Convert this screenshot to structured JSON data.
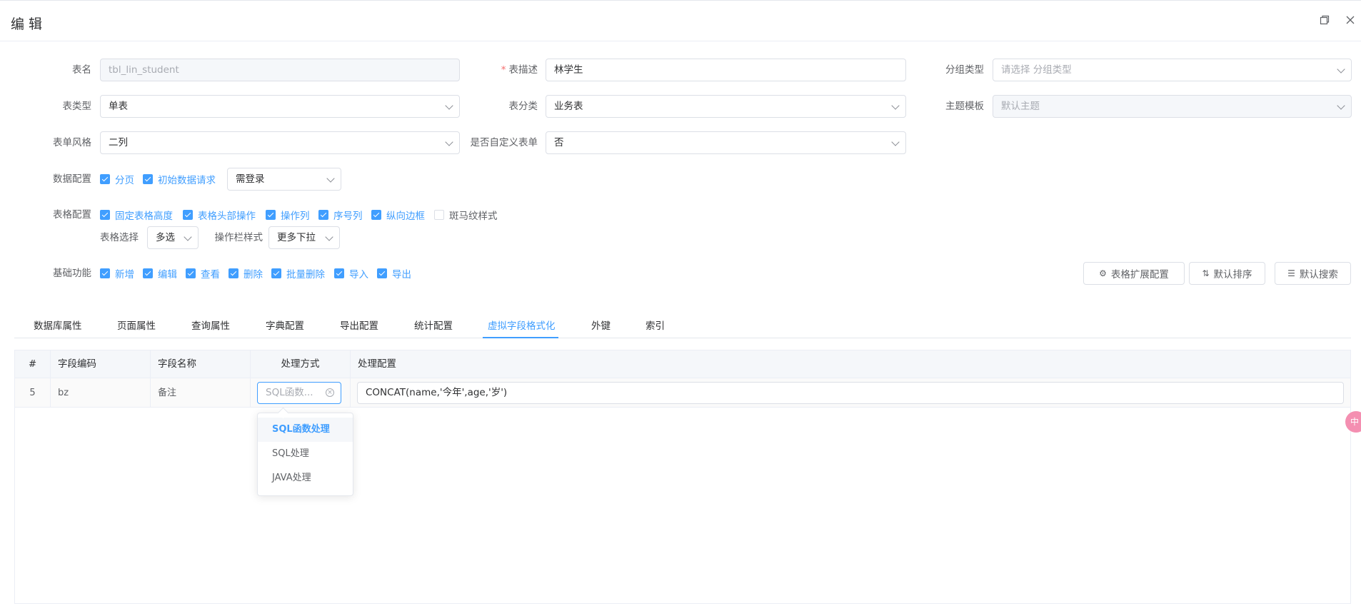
{
  "dialog": {
    "title": "编 辑",
    "restore_icon": "restore-icon",
    "close_icon": "close-icon"
  },
  "form": {
    "table_name": {
      "label": "表名",
      "value": "tbl_lin_student"
    },
    "table_desc": {
      "label": "表描述",
      "required_mark": "*",
      "value": "林学生"
    },
    "group_type": {
      "label": "分组类型",
      "placeholder": "请选择 分组类型"
    },
    "table_type": {
      "label": "表类型",
      "value": "单表"
    },
    "table_category": {
      "label": "表分类",
      "value": "业务表"
    },
    "theme_template": {
      "label": "主题模板",
      "value": "默认主题"
    },
    "form_style": {
      "label": "表单风格",
      "value": "二列"
    },
    "custom_form": {
      "label": "是否自定义表单",
      "value": "否"
    },
    "data_config": {
      "label": "数据配置",
      "checks": [
        {
          "label": "分页",
          "checked": true
        },
        {
          "label": "初始数据请求",
          "checked": true
        }
      ],
      "login_select": "需登录"
    },
    "table_config": {
      "label": "表格配置",
      "checks": [
        {
          "label": "固定表格高度",
          "checked": true
        },
        {
          "label": "表格头部操作",
          "checked": true
        },
        {
          "label": "操作列",
          "checked": true
        },
        {
          "label": "序号列",
          "checked": true
        },
        {
          "label": "纵向边框",
          "checked": true
        },
        {
          "label": "斑马纹样式",
          "checked": false
        }
      ],
      "select_label": "表格选择",
      "select_value": "多选",
      "action_style_label": "操作栏样式",
      "action_style_value": "更多下拉"
    },
    "basic_functions": {
      "label": "基础功能",
      "checks": [
        {
          "label": "新增",
          "checked": true
        },
        {
          "label": "编辑",
          "checked": true
        },
        {
          "label": "查看",
          "checked": true
        },
        {
          "label": "删除",
          "checked": true
        },
        {
          "label": "批量删除",
          "checked": true
        },
        {
          "label": "导入",
          "checked": true
        },
        {
          "label": "导出",
          "checked": true
        }
      ]
    }
  },
  "buttons": {
    "table_ext": "表格扩展配置",
    "default_sort": "默认排序",
    "default_search": "默认搜索"
  },
  "tabs": [
    {
      "label": "数据库属性",
      "active": false
    },
    {
      "label": "页面属性",
      "active": false
    },
    {
      "label": "查询属性",
      "active": false
    },
    {
      "label": "字典配置",
      "active": false
    },
    {
      "label": "导出配置",
      "active": false
    },
    {
      "label": "统计配置",
      "active": false
    },
    {
      "label": "虚拟字段格式化",
      "active": true
    },
    {
      "label": "外键",
      "active": false
    },
    {
      "label": "索引",
      "active": false
    }
  ],
  "table": {
    "headers": [
      "#",
      "字段编码",
      "字段名称",
      "处理方式",
      "处理配置"
    ],
    "rows": [
      {
        "index": "5",
        "code": "bz",
        "name": "备注",
        "method_placeholder": "SQL函数...",
        "config": "CONCAT(name,'今年',age,'岁')"
      }
    ]
  },
  "dropdown": {
    "options": [
      {
        "label": "SQL函数处理",
        "selected": true
      },
      {
        "label": "SQL处理",
        "selected": false
      },
      {
        "label": "JAVA处理",
        "selected": false
      }
    ]
  },
  "floating_badge": "中",
  "colors": {
    "primary": "#409eff",
    "border": "#dcdfe6",
    "required": "#f56c6c"
  }
}
